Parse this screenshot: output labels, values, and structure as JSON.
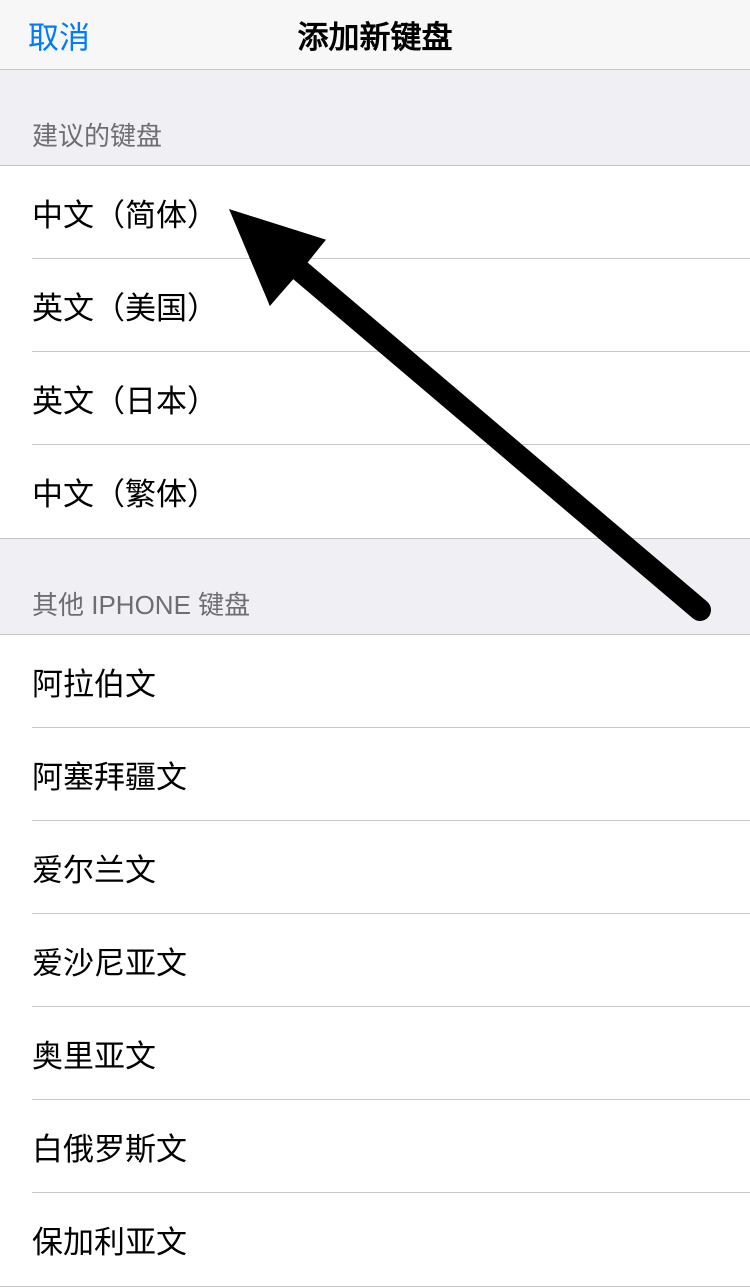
{
  "nav": {
    "cancel_label": "取消",
    "title": "添加新键盘"
  },
  "sections": {
    "suggested": {
      "header": "建议的键盘",
      "items": [
        {
          "label": "中文（简体）"
        },
        {
          "label": "英文（美国）"
        },
        {
          "label": "英文（日本）"
        },
        {
          "label": "中文（繁体）"
        }
      ]
    },
    "other": {
      "header": "其他 IPHONE 键盘",
      "items": [
        {
          "label": "阿拉伯文"
        },
        {
          "label": "阿塞拜疆文"
        },
        {
          "label": "爱尔兰文"
        },
        {
          "label": "爱沙尼亚文"
        },
        {
          "label": "奥里亚文"
        },
        {
          "label": "白俄罗斯文"
        },
        {
          "label": "保加利亚文"
        }
      ]
    }
  }
}
